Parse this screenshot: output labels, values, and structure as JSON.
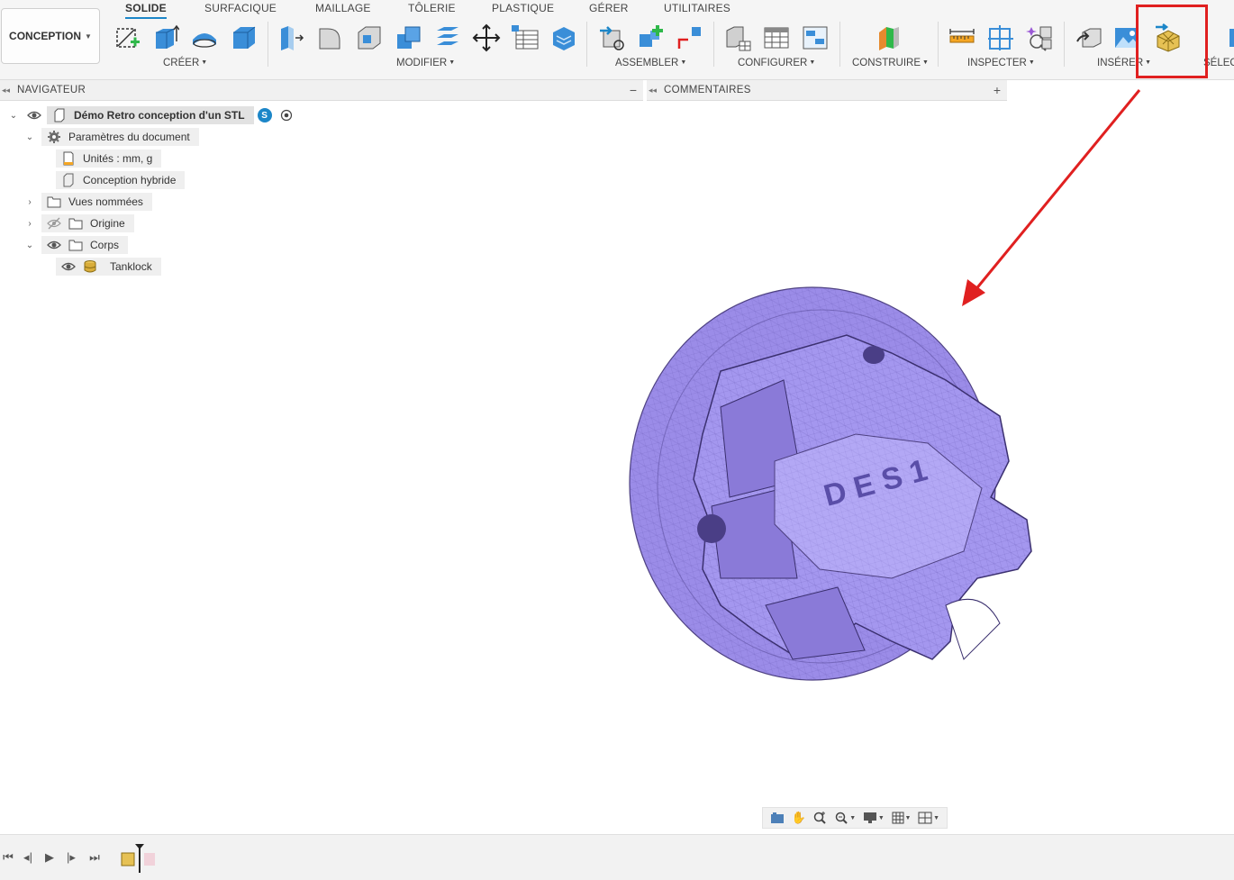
{
  "toolbar": {
    "workspace": "CONCEPTION",
    "tabs": [
      "SOLIDE",
      "SURFACIQUE",
      "MAILLAGE",
      "TÔLERIE",
      "PLASTIQUE",
      "GÉRER",
      "UTILITAIRES"
    ],
    "active_tab": "SOLIDE",
    "groups": [
      "CRÉER",
      "MODIFIER",
      "ASSEMBLER",
      "CONFIGURER",
      "CONSTRUIRE",
      "INSPECTER",
      "INSÉRER",
      "SÉLEC"
    ]
  },
  "navigator": {
    "title": "NAVIGATEUR",
    "collapse_icon": "double-chevron-left-icon",
    "action_icon": "minus-icon",
    "tree": {
      "root": "Démo Retro conception d'un STL",
      "root_badge": "S",
      "document_settings": "Paramètres du document",
      "units": "Unités : mm, g",
      "design_type": "Conception hybride",
      "named_views": "Vues nommées",
      "origin": "Origine",
      "bodies": "Corps",
      "body_item": "Tanklock"
    }
  },
  "comments": {
    "title": "COMMENTAIRES",
    "action_icon": "plus-icon"
  },
  "viewport": {
    "model_color": "#9b8ce8",
    "engraved_text": "D E S 1"
  },
  "annotation": {
    "color": "#e02020"
  },
  "navbar_icons": [
    "camera-icon",
    "pan-icon",
    "zoom-icon",
    "zoom-window-icon",
    "display-icon",
    "grid-icon",
    "viewports-icon"
  ],
  "timeline_icons": [
    "skip-start-icon",
    "step-back-icon",
    "play-icon",
    "step-forward-icon",
    "skip-end-icon"
  ]
}
